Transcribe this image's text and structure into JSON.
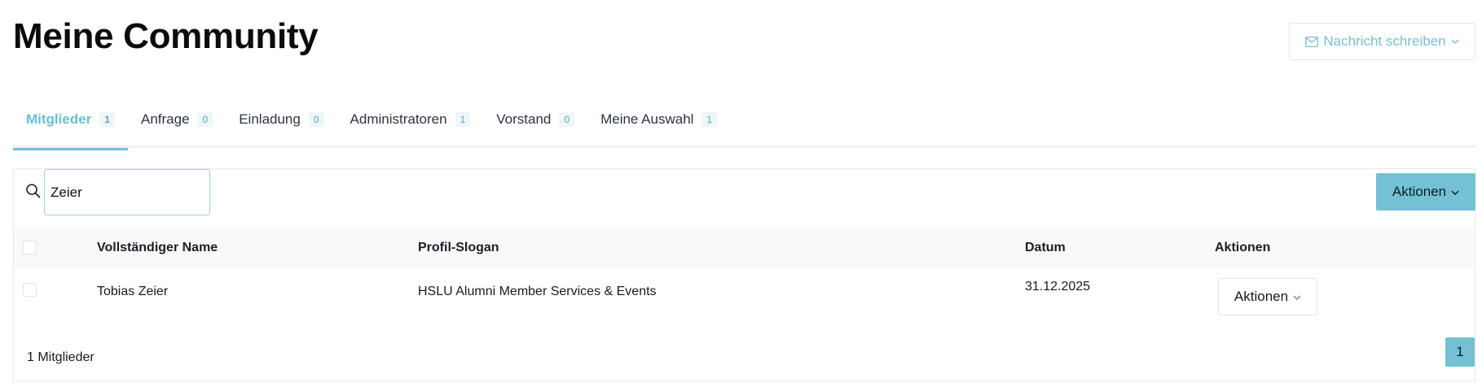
{
  "header": {
    "title": "Meine Community",
    "message_button_label": "Nachricht schreiben"
  },
  "tabs": [
    {
      "label": "Mitglieder",
      "count": "1",
      "active": true
    },
    {
      "label": "Anfrage",
      "count": "0"
    },
    {
      "label": "Einladung",
      "count": "0"
    },
    {
      "label": "Administratoren",
      "count": "1"
    },
    {
      "label": "Vorstand",
      "count": "0"
    },
    {
      "label": "Meine Auswahl",
      "count": "1"
    }
  ],
  "toolbar": {
    "search_value": "Zeier",
    "actions_label": "Aktionen"
  },
  "table": {
    "columns": [
      "Vollständiger Name",
      "Profil-Slogan",
      "Datum",
      "Aktionen"
    ],
    "rows": [
      {
        "name": "Tobias Zeier",
        "slogan": "HSLU Alumni Member Services & Events",
        "date": "31.12.2025",
        "actions_label": "Aktionen"
      }
    ]
  },
  "footer": {
    "count_text": "1 Mitglieder",
    "current_page": "1"
  },
  "colors": {
    "accent": "#74c1d4",
    "border": "#e6e9ec",
    "header_bg": "#f8f9fb"
  }
}
